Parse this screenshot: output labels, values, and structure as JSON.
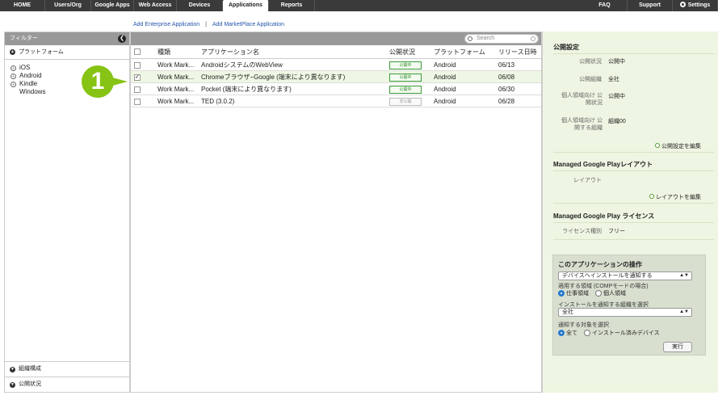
{
  "nav": {
    "left": [
      {
        "label": "HOME",
        "w": 56
      },
      {
        "label": "Users/Org",
        "w": 57
      },
      {
        "label": "Google Apps",
        "w": 53
      },
      {
        "label": "Web Access",
        "w": 53
      },
      {
        "label": "Devices",
        "w": 57
      },
      {
        "label": "Applications",
        "w": 57,
        "active": true
      },
      {
        "label": "Reports",
        "w": 57
      }
    ],
    "right": [
      {
        "label": "FAQ",
        "w": 56
      },
      {
        "label": "Support",
        "w": 56
      },
      {
        "label": "Settings",
        "w": 56,
        "gear": true
      }
    ]
  },
  "links": {
    "add_enterprise": "Add Enterprise Application",
    "sep": "|",
    "add_marketplace": "Add MarketPlace Application"
  },
  "filter": {
    "title": "フィルター",
    "platform_section": "プラットフォーム",
    "platforms": [
      "iOS",
      "Android",
      "Kindle",
      "Windows"
    ],
    "org_section": "組織構成",
    "status_section": "公開状況"
  },
  "table": {
    "search_placeholder": "Search",
    "headers": {
      "type": "種類",
      "name": "アプリケーション名",
      "status": "公開状況",
      "platform": "プラットフォーム",
      "release": "リリース日時"
    },
    "rows": [
      {
        "type": "Work Mark...",
        "name": "AndroidシステムのWebView",
        "status": "公開中",
        "platform": "Android",
        "date": "06/13",
        "selected": false,
        "published": true
      },
      {
        "type": "Work Mark...",
        "name": "Chromeブラウザ−Google (端末により異なります)",
        "status": "公開中",
        "platform": "Android",
        "date": "06/08",
        "selected": true,
        "published": true
      },
      {
        "type": "Work Mark...",
        "name": "Pocket (端末により異なります)",
        "status": "公開中",
        "platform": "Android",
        "date": "06/30",
        "selected": false,
        "published": true
      },
      {
        "type": "Work Mark...",
        "name": "TED (3.0.2)",
        "status": "非公開",
        "platform": "Android",
        "date": "06/28",
        "selected": false,
        "published": false
      }
    ]
  },
  "callout": {
    "number": "1"
  },
  "right": {
    "pub_title": "公開設定",
    "pub_status_label": "公開状況",
    "pub_status_value": "公開中",
    "pub_org_label": "公開組織",
    "pub_org_value": "全社",
    "personal_status_label": "個人領域向け 公開状況",
    "personal_status_value": "公開中",
    "personal_org_label": "個人領域向け 公開する組織",
    "personal_org_value": "組織00",
    "edit_pub": "公開設定を編集",
    "layout_title": "Managed Google Playレイアウト",
    "layout_label": "レイアウト",
    "edit_layout": "レイアウトを編集",
    "license_title": "Managed Google Play ライセンス",
    "license_label": "ライセンス種別",
    "license_value": "フリー",
    "ops": {
      "title": "このアプリケーションの操作",
      "action_select": "デバイスへインストールを通知する",
      "area_label": "適用する領域 (COMPモードの場合)",
      "area_work": "仕事領域",
      "area_personal": "個人領域",
      "org_label": "インストールを通知する組織を選択",
      "org_select": "全社",
      "target_label": "通知する対象を選択",
      "target_all": "全て",
      "target_installed": "インストール済みデバイス",
      "exec": "実行"
    }
  }
}
